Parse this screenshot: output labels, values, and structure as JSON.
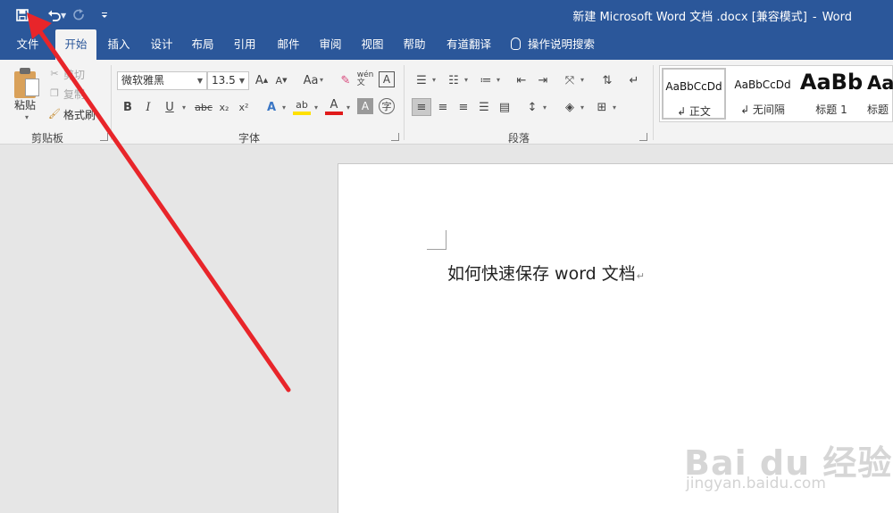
{
  "window": {
    "title_doc": "新建 Microsoft Word 文档 .docx [兼容模式]",
    "title_sep": "-",
    "title_app": "Word"
  },
  "quick_access": {
    "save_icon": "save-icon",
    "undo_icon": "undo-icon",
    "redo_icon": "redo-icon",
    "customize_icon": "customize-qat-icon"
  },
  "tabs": [
    "文件",
    "开始",
    "插入",
    "设计",
    "布局",
    "引用",
    "邮件",
    "审阅",
    "视图",
    "帮助",
    "有道翻译"
  ],
  "active_tab": "开始",
  "tell_me": "操作说明搜索",
  "clipboard": {
    "paste": "粘贴",
    "cut": "剪切",
    "copy": "复制",
    "format_painter": "格式刷",
    "group_label": "剪贴板"
  },
  "font": {
    "name": "微软雅黑",
    "size": "13.5",
    "change_case": "Aa",
    "bold": "B",
    "italic": "I",
    "underline": "U",
    "strikethrough": "abc",
    "subscript": "x₂",
    "superscript": "x²",
    "group_label": "字体"
  },
  "paragraph": {
    "group_label": "段落"
  },
  "styles": [
    {
      "sample": "AaBbCcDd",
      "name": "↲ 正文"
    },
    {
      "sample": "AaBbCcDd",
      "name": "↲ 无间隔"
    },
    {
      "sample": "AaBb",
      "name": "标题 1"
    },
    {
      "sample": "Aal",
      "name": "标题"
    }
  ],
  "document": {
    "text": "如何快速保存 word 文档",
    "paragraph_mark": "↵"
  },
  "watermark": {
    "brand": "Bai du 经验",
    "url": "jingyan.baidu.com"
  },
  "colors": {
    "titlebar": "#2b579a",
    "ribbon": "#f3f3f3",
    "annotation_arrow": "#e8252a"
  }
}
